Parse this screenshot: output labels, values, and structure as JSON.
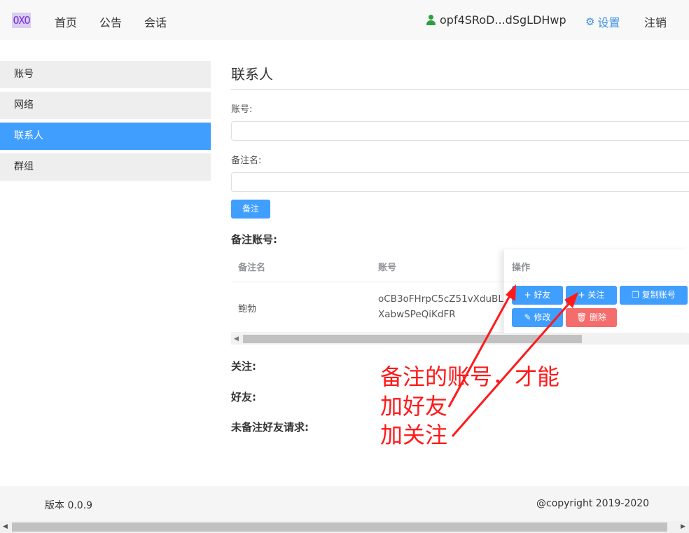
{
  "nav": {
    "logo": "OXO",
    "home": "首页",
    "notice": "公告",
    "chat": "会话",
    "user": "opf4SRoD...dSgLDHwp",
    "settings": "设置",
    "logout": "注销",
    "icons": {
      "user": "user-icon",
      "settings": "gear-icon"
    },
    "colors": {
      "accent": "#409eff",
      "user_icon": "#2f9e3e",
      "logo": "#7a2fd6"
    }
  },
  "sidebar": {
    "items": [
      {
        "label": "账号",
        "active": false
      },
      {
        "label": "网络",
        "active": false
      },
      {
        "label": "联系人",
        "active": true
      },
      {
        "label": "群组",
        "active": false
      }
    ]
  },
  "main": {
    "title": "联系人",
    "form": {
      "account_label": "账号:",
      "account_value": "",
      "remark_label": "备注名:",
      "remark_value": "",
      "submit": "备注"
    },
    "remarked_section": "备注账号:",
    "table": {
      "columns": [
        "备注名",
        "账号",
        "操作"
      ],
      "rows": [
        {
          "name": "鲍勃",
          "account": "oCB3oFHrpC5cZ51vXduBLXabwSPeQiKdFR"
        }
      ],
      "actions": {
        "add_friend": "+ 好友",
        "follow": "+ 关注",
        "copy": "复制账号",
        "edit": "修改",
        "delete": "删除"
      }
    },
    "follow_section": "关注:",
    "friends_section": "好友:",
    "requests_section": "未备注好友请求:"
  },
  "annotation": {
    "lines": [
      "备注的账号，才能",
      "加好友",
      "加关注"
    ],
    "color": "#ff1a1a"
  },
  "footer": {
    "version": "版本 0.0.9",
    "copyright": "@copyright 2019-2020"
  }
}
